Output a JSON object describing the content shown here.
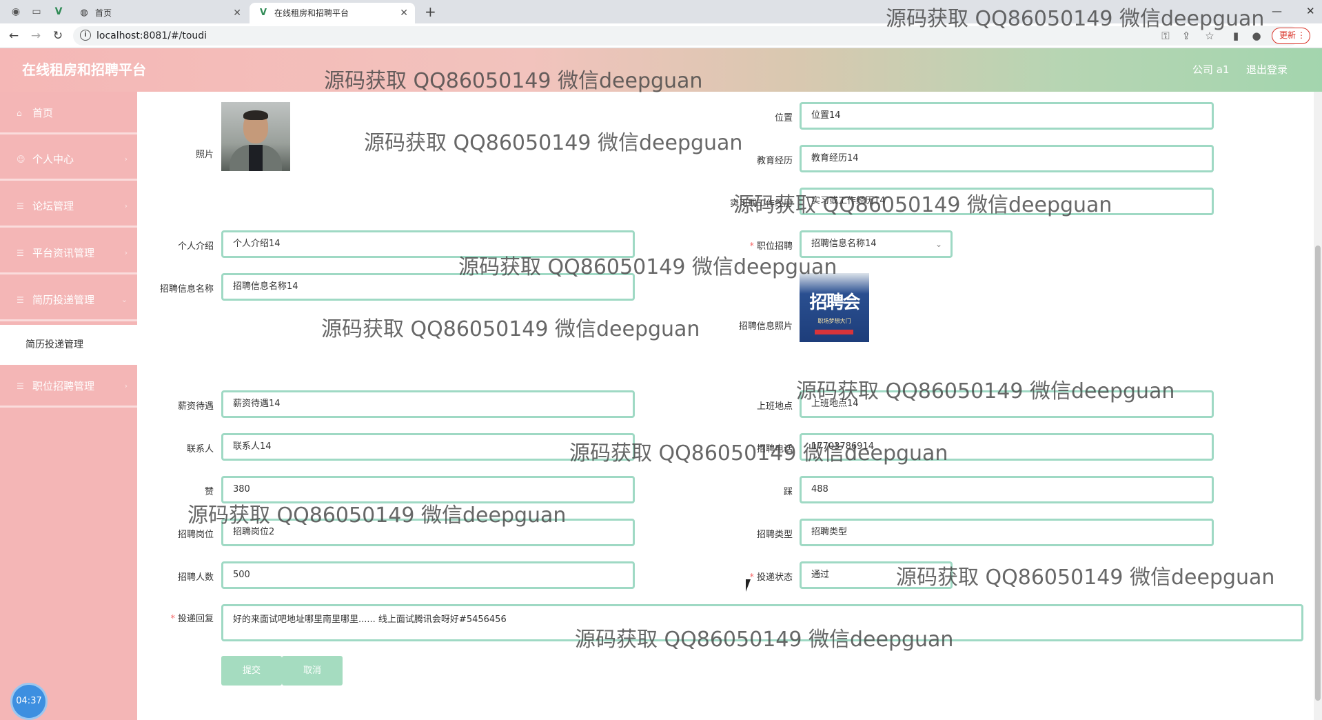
{
  "browser": {
    "tabs": [
      {
        "label": "首页"
      },
      {
        "label": "在线租房和招聘平台"
      }
    ],
    "url": "localhost:8081/#/toudi",
    "update_label": "更新"
  },
  "header": {
    "brand": "在线租房和招聘平台",
    "user": "公司 a1",
    "logout": "退出登录"
  },
  "sidebar": {
    "items": [
      {
        "label": "首页"
      },
      {
        "label": "个人中心"
      },
      {
        "label": "论坛管理"
      },
      {
        "label": "平台资讯管理"
      },
      {
        "label": "简历投递管理"
      },
      {
        "label": "职位招聘管理"
      }
    ],
    "active_sub": "简历投递管理",
    "clock": "04:37"
  },
  "form": {
    "photo_label": "照片",
    "location_label": "位置",
    "location_value": "位置14",
    "education_label": "教育经历",
    "education_value": "教育经历14",
    "internship_label": "实习或工作经历",
    "internship_value": "实习或工作经历14",
    "intro_label": "个人介绍",
    "intro_value": "个人介绍14",
    "job_label": "职位招聘",
    "job_value": "招聘信息名称14",
    "recruit_name_label": "招聘信息名称",
    "recruit_name_value": "招聘信息名称14",
    "recruit_photo_label": "招聘信息照片",
    "recruit_photo_text": "招聘会",
    "recruit_photo_sub": "职场梦想大门",
    "salary_label": "薪资待遇",
    "salary_value": "薪资待遇14",
    "workplace_label": "上班地点",
    "workplace_value": "上班地点14",
    "contact_label": "联系人",
    "contact_value": "联系人14",
    "phone_label": "招聘电话",
    "phone_value": "17703786914",
    "like_label": "赞",
    "like_value": "380",
    "dislike_label": "踩",
    "dislike_value": "488",
    "position_label": "招聘岗位",
    "position_value": "招聘岗位2",
    "type_label": "招聘类型",
    "type_value": "招聘类型",
    "count_label": "招聘人数",
    "count_value": "500",
    "status_label": "投递状态",
    "status_value": "通过",
    "reply_label": "投递回复",
    "reply_value": "好的来面试吧地址哪里南里哪里......      线上面试腾讯会呀好#5456456",
    "submit": "提交",
    "cancel": "取消"
  },
  "watermark": "源码获取 QQ86050149 微信deepguan"
}
